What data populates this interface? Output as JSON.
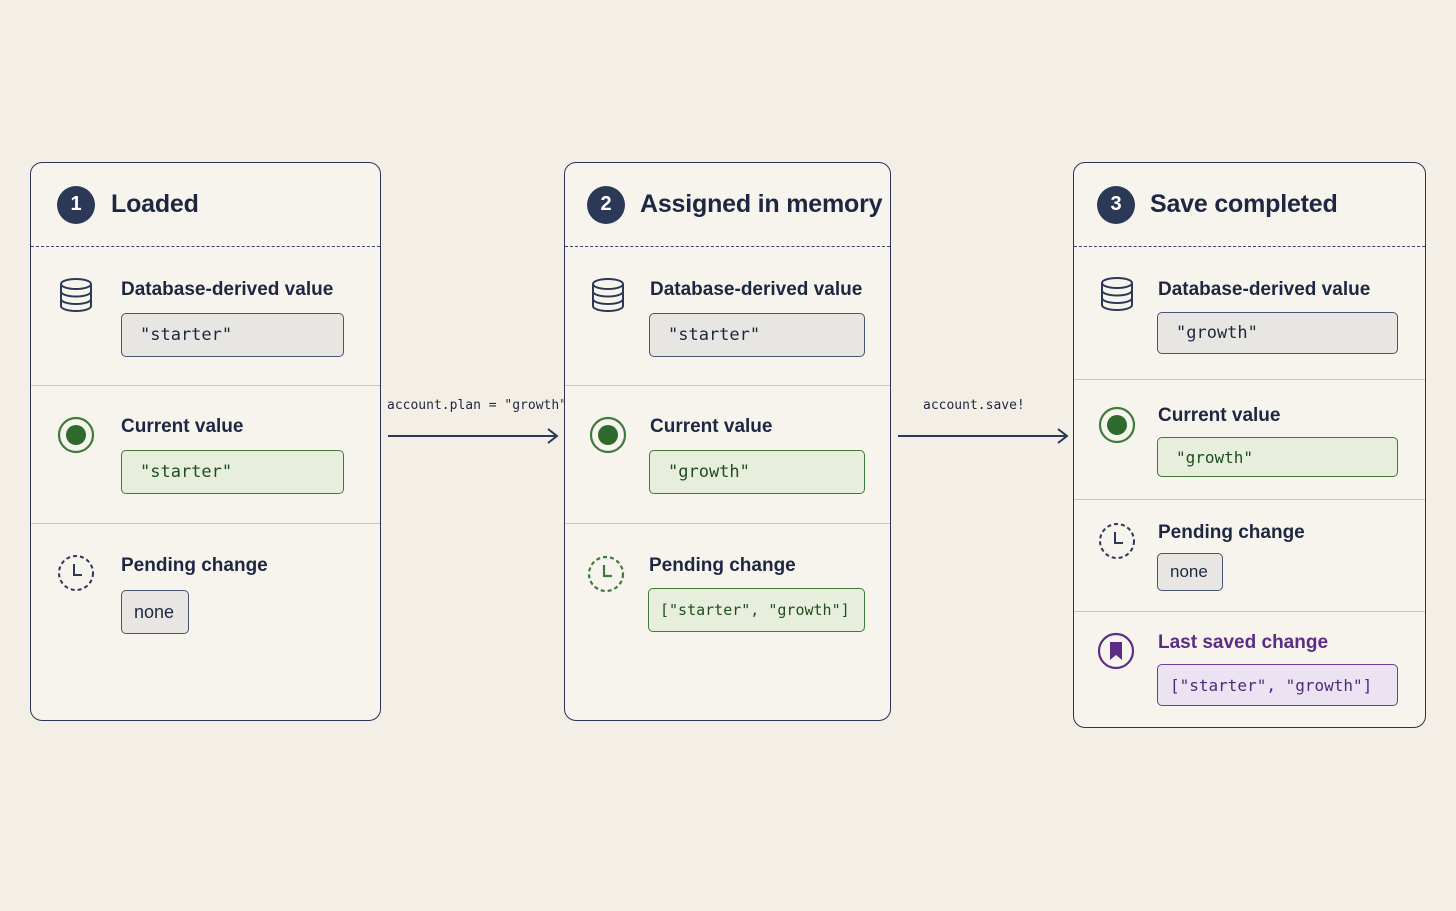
{
  "steps": [
    {
      "number": "1",
      "title": "Loaded",
      "database": {
        "label": "Database-derived value",
        "value": "\"starter\""
      },
      "current": {
        "label": "Current value",
        "value": "\"starter\""
      },
      "pending": {
        "label": "Pending change",
        "value": "none"
      }
    },
    {
      "number": "2",
      "title": "Assigned in memory",
      "database": {
        "label": "Database-derived value",
        "value": "\"starter\""
      },
      "current": {
        "label": "Current value",
        "value": "\"growth\""
      },
      "pending": {
        "label": "Pending change",
        "value": "[\"starter\", \"growth\"]"
      }
    },
    {
      "number": "3",
      "title": "Save completed",
      "database": {
        "label": "Database-derived value",
        "value": "\"growth\""
      },
      "current": {
        "label": "Current value",
        "value": "\"growth\""
      },
      "pending": {
        "label": "Pending change",
        "value": "none"
      },
      "last_saved": {
        "label": "Last saved change",
        "value": "[\"starter\", \"growth\"]"
      }
    }
  ],
  "transitions": [
    {
      "label": "account.plan = \"growth\""
    },
    {
      "label": "account.save!"
    }
  ],
  "icons": {
    "database": "database-icon",
    "current": "current-value-icon",
    "pending": "clock-icon",
    "last_saved": "bookmark-icon"
  },
  "colors": {
    "background": "#f4efe6",
    "ink": "#2b3856",
    "green": "#3f7a3c",
    "purple": "#6d3d98"
  }
}
